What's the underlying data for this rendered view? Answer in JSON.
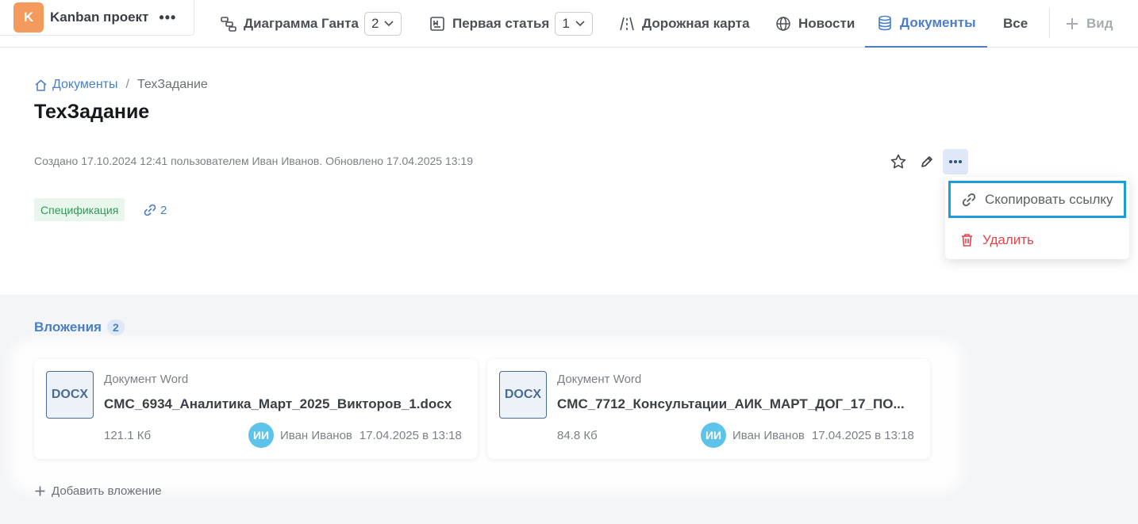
{
  "project": {
    "avatar_letter": "K",
    "name": "Kanban проект",
    "more": "•••"
  },
  "tabs": [
    {
      "label": "Диаграмма Ганта",
      "count": "2"
    },
    {
      "label": "Первая статья",
      "count": "1"
    },
    {
      "label": "Дорожная карта"
    },
    {
      "label": "Новости"
    },
    {
      "label": "Документы"
    },
    {
      "label": "Все"
    },
    {
      "label": "Вид"
    }
  ],
  "breadcrumb": {
    "root": "Документы",
    "separator": "/",
    "current": "ТехЗадание"
  },
  "page": {
    "title": "ТехЗадание",
    "meta": "Создано 17.10.2024 12:41 пользователем Иван Иванов. Обновлено 17.04.2025 13:19",
    "tag": "Спецификация",
    "links_count": "2"
  },
  "menu": {
    "copy_link": "Скопировать ссылку",
    "delete": "Удалить"
  },
  "attachments": {
    "title": "Вложения",
    "count": "2",
    "add_label": "Добавить вложение",
    "items": [
      {
        "icon_text": "DOCX",
        "type": "Документ Word",
        "name": "CMC_6934_Аналитика_Март_2025_Викторов_1.docx",
        "size": "121.1 Кб",
        "avatar": "ИИ",
        "author": "Иван Иванов",
        "date": "17.04.2025 в 13:18"
      },
      {
        "icon_text": "DOCX",
        "type": "Документ Word",
        "name": "CMC_7712_Консультации_АИК_МАРТ_ДОГ_17_ПО...",
        "size": "84.8 Кб",
        "avatar": "ИИ",
        "author": "Иван Иванов",
        "date": "17.04.2025 в 13:18"
      }
    ]
  },
  "colors": {
    "accent": "#4a7ec6",
    "project_avatar": "#f39a5c",
    "danger": "#e0474c",
    "tag_green": "#2f9a57",
    "highlight": "#1a9fdc"
  }
}
